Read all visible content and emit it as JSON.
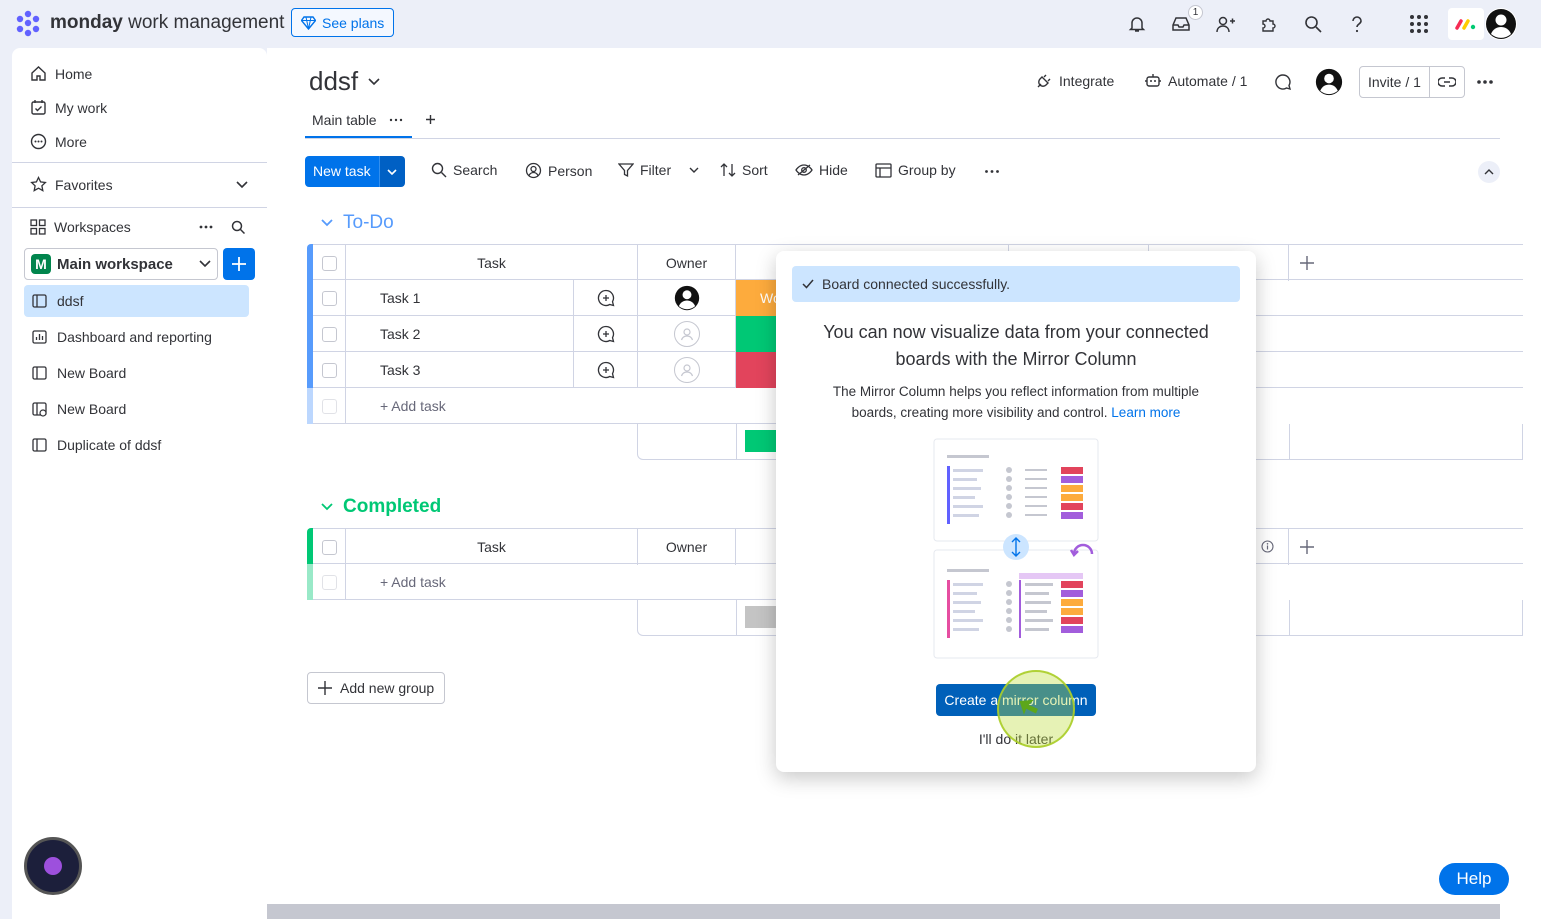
{
  "app": {
    "brand": "monday",
    "product": "work management",
    "see_plans": "See plans",
    "inbox_count": "1"
  },
  "sidebar": {
    "nav": [
      {
        "label": "Home",
        "icon": "home-icon"
      },
      {
        "label": "My work",
        "icon": "calendar-check-icon"
      },
      {
        "label": "More",
        "icon": "more-circle-icon"
      }
    ],
    "favorites": "Favorites",
    "workspaces": "Workspaces",
    "workspace_letter": "M",
    "workspace_name": "Main workspace",
    "boards": [
      {
        "label": "ddsf",
        "selected": true
      },
      {
        "label": "Dashboard and reporting",
        "selected": false
      },
      {
        "label": "New Board",
        "selected": false
      },
      {
        "label": "New Board",
        "selected": false
      },
      {
        "label": "Duplicate of ddsf",
        "selected": false
      }
    ]
  },
  "board": {
    "title": "ddsf",
    "integrate": "Integrate",
    "automate": "Automate / 1",
    "invite": "Invite / 1",
    "tab": "Main table",
    "new_task": "New task",
    "tools": {
      "search": "Search",
      "person": "Person",
      "filter": "Filter",
      "sort": "Sort",
      "hide": "Hide",
      "group_by": "Group by"
    },
    "groups": [
      {
        "title": "To-Do",
        "color": "#579bfc",
        "col_task": "Task",
        "col_owner": "Owner",
        "tasks": [
          {
            "name": "Task 1",
            "status_color": "#fdab3d",
            "status_text": "Wo"
          },
          {
            "name": "Task 2",
            "status_color": "#00c875",
            "status_text": ""
          },
          {
            "name": "Task 3",
            "status_color": "#e2445c",
            "status_text": ""
          }
        ],
        "add_task": "+ Add task"
      },
      {
        "title": "Completed",
        "color": "#00c875",
        "col_task": "Task",
        "col_owner": "Owner",
        "tasks": [],
        "add_task": "+ Add task"
      }
    ],
    "add_group": "Add new group",
    "help": "Help"
  },
  "popup": {
    "toast": "Board connected successfully.",
    "title": "You can now visualize data from your connected boards with the Mirror Column",
    "body": "The Mirror Column helps you reflect information from multiple boards, creating more visibility and control.",
    "learn_more": "Learn more",
    "primary": "Create a mirror column",
    "secondary": "I'll do it later"
  }
}
